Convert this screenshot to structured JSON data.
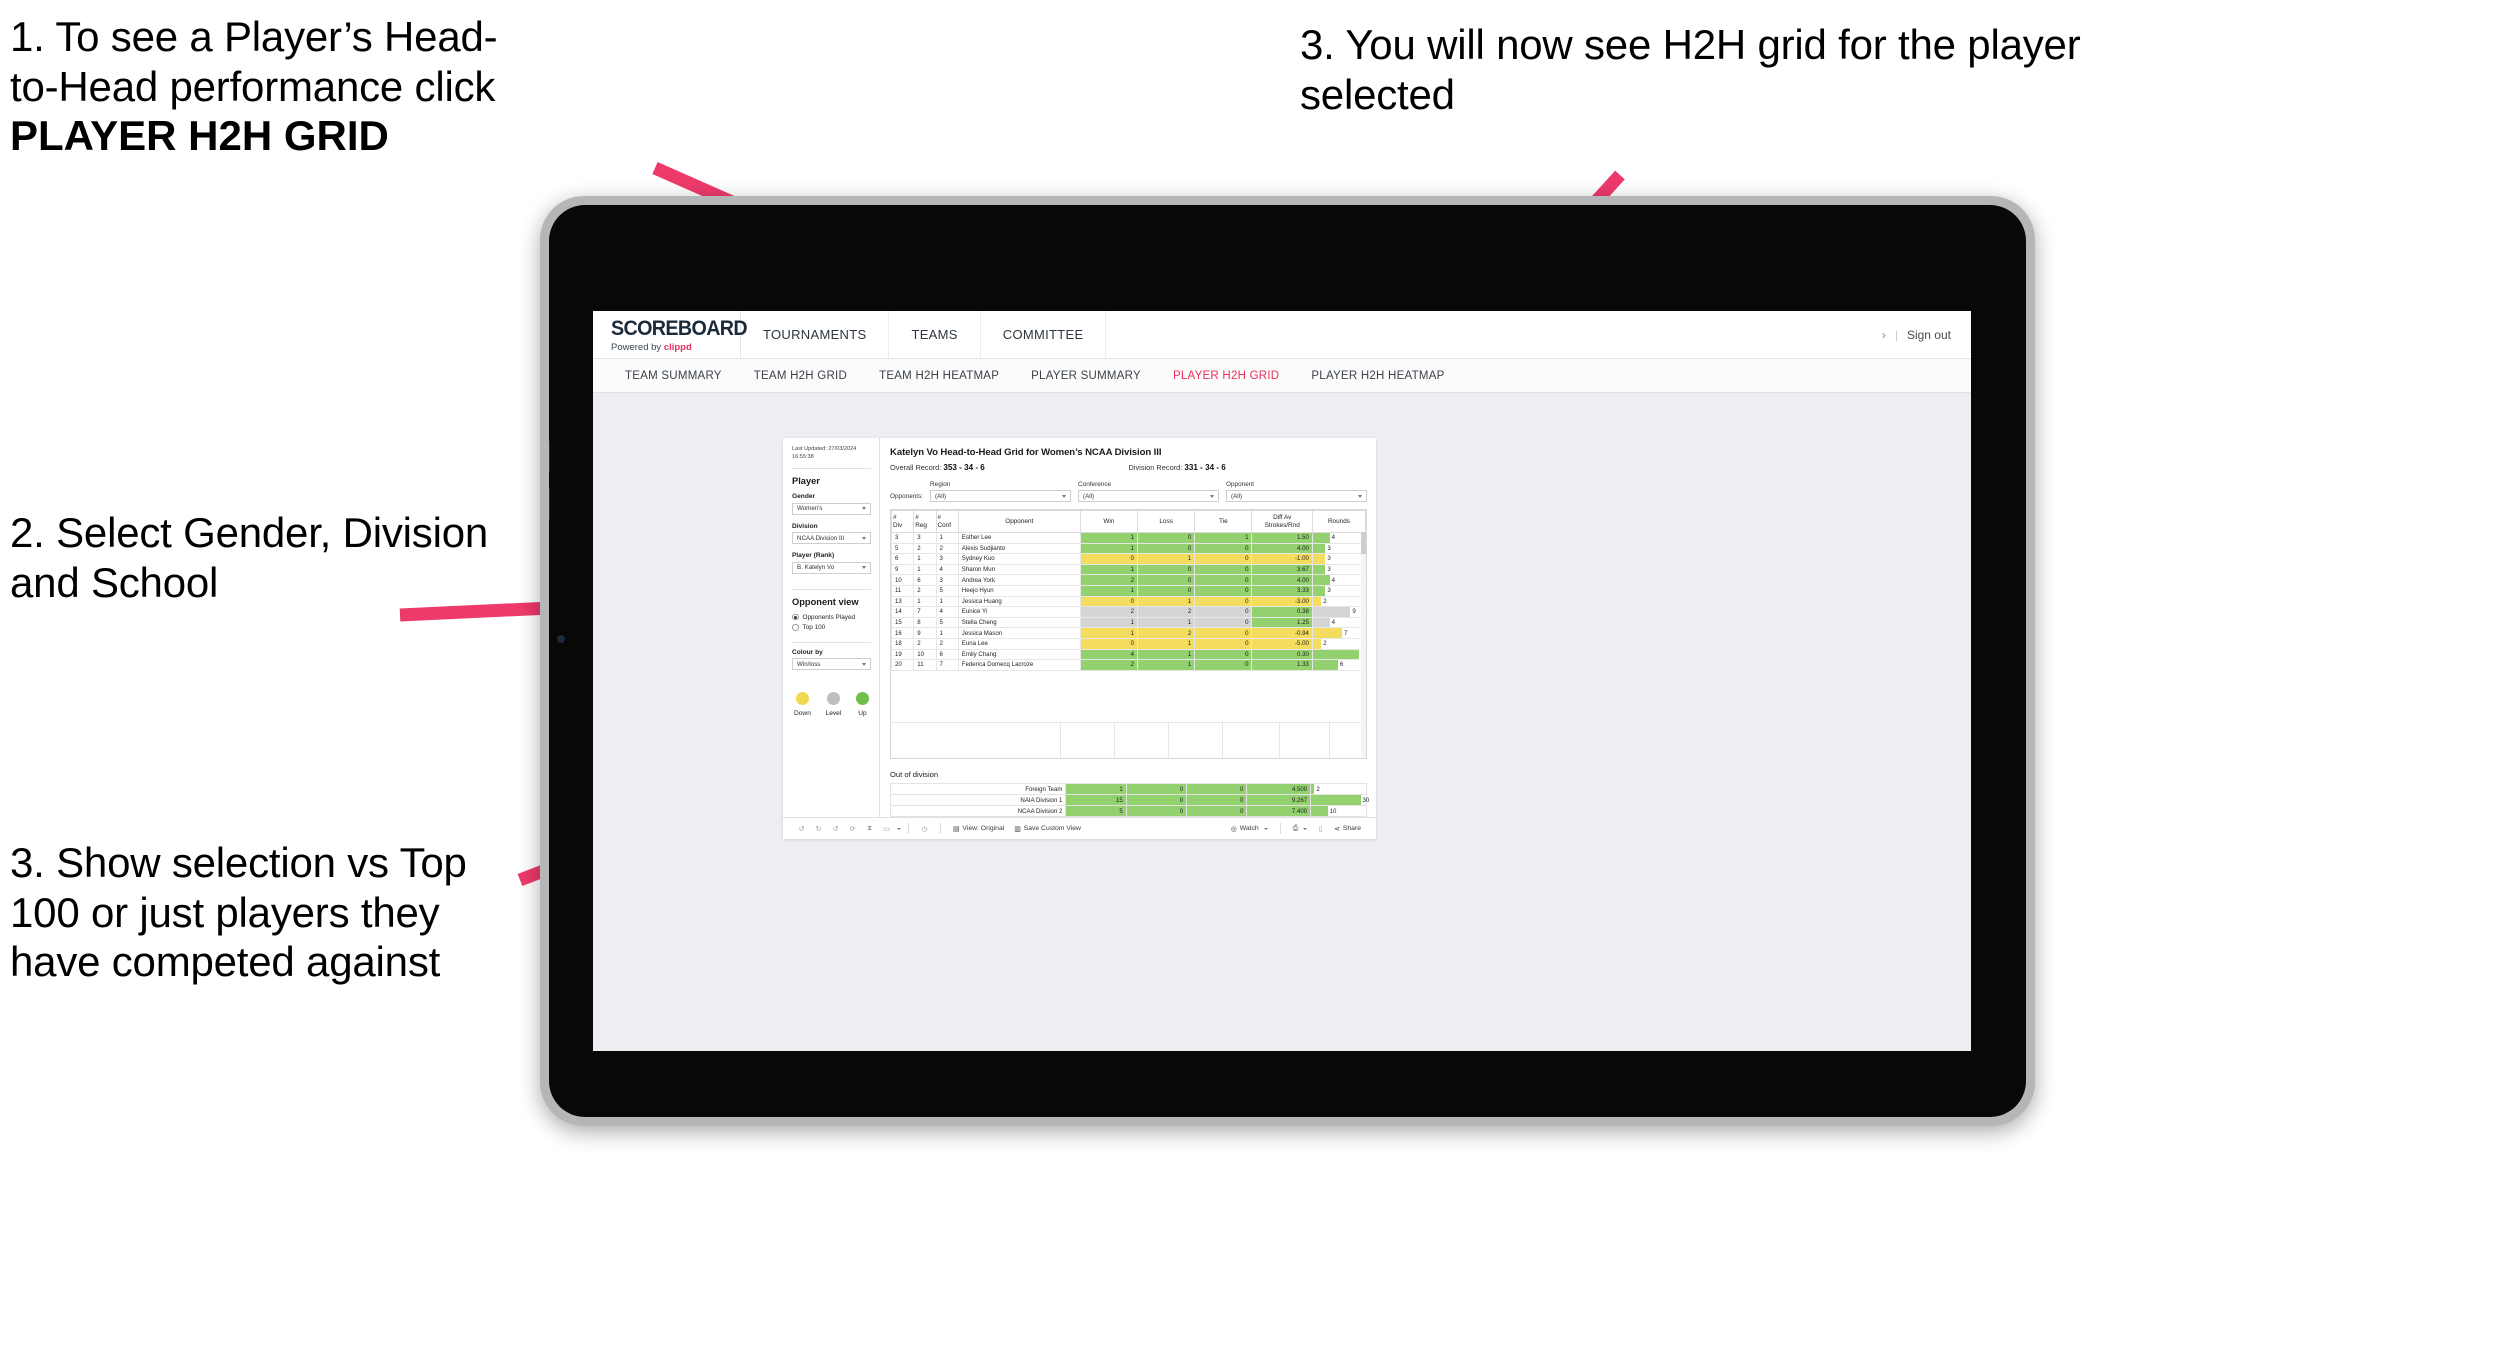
{
  "annotations": {
    "a1_line1": "1. To see a Player’s Head-",
    "a1_line2": "to-Head performance click",
    "a1_bold": "PLAYER H2H GRID",
    "a2": "2. Select Gender, Division and School",
    "a3": "3. Show selection vs Top 100 or just players they have competed against",
    "a4": "3. You will now see H2H grid for the player selected",
    "arrow_color": "#ee3a6b"
  },
  "app": {
    "brand": {
      "logo": "SCOREBOARD",
      "powered_prefix": "Powered by ",
      "powered_brand": "clippd"
    },
    "topnav": [
      "TOURNAMENTS",
      "TEAMS",
      "COMMITTEE"
    ],
    "account": {
      "chevron": "›",
      "divider": "|",
      "sign_out": "Sign out"
    },
    "subnav": [
      {
        "label": "TEAM SUMMARY",
        "active": false
      },
      {
        "label": "TEAM H2H GRID",
        "active": false
      },
      {
        "label": "TEAM H2H HEATMAP",
        "active": false
      },
      {
        "label": "PLAYER SUMMARY",
        "active": false
      },
      {
        "label": "PLAYER H2H GRID",
        "active": true
      },
      {
        "label": "PLAYER H2H HEATMAP",
        "active": false
      }
    ],
    "accent": "#e8305c"
  },
  "pane": {
    "updated_label": "Last Updated: 27/03/2024",
    "updated_time": "16:55:38",
    "player_heading": "Player",
    "filters": [
      {
        "label": "Gender",
        "value": "Women's"
      },
      {
        "label": "Division",
        "value": "NCAA Division III"
      },
      {
        "label": "Player (Rank)",
        "value": "B. Katelyn Vo"
      }
    ],
    "opponent_view_heading": "Opponent view",
    "opponent_view_options": [
      {
        "label": "Opponents Played",
        "selected": true
      },
      {
        "label": "Top 100",
        "selected": false
      }
    ],
    "colour_by_label": "Colour by",
    "colour_by_value": "Win/loss",
    "legend": [
      {
        "label": "Down",
        "color": "#f2d84f"
      },
      {
        "label": "Level",
        "color": "#bfbfbf"
      },
      {
        "label": "Up",
        "color": "#6fbf4a"
      }
    ]
  },
  "viz": {
    "title": "Katelyn Vo Head-to-Head Grid for Women’s NCAA Division III",
    "overall_record_label": "Overall Record:",
    "overall_record_value": "353 - 34 - 6",
    "division_record_label": "Division Record:",
    "division_record_value": "331 - 34 - 6",
    "opponents_label": "Opponents:",
    "opponent_filters": [
      {
        "label": "Region",
        "value": "(All)"
      },
      {
        "label": "Conference",
        "value": "(All)"
      },
      {
        "label": "Opponent",
        "value": "(All)"
      }
    ],
    "out_of_division_title": "Out of division"
  },
  "chart_data": {
    "type": "table",
    "title": "Katelyn Vo Head-to-Head Grid for Women’s NCAA Division III",
    "columns": [
      "# Div",
      "# Reg",
      "# Conf",
      "Opponent",
      "Win",
      "Loss",
      "Tie",
      "Diff Av Strokes/Rnd",
      "Rounds"
    ],
    "column_headers_two_line": {
      "div": [
        "#",
        "Div"
      ],
      "reg": [
        "#",
        "Reg"
      ],
      "conf": [
        "#",
        "Conf"
      ],
      "opponent": [
        "Opponent"
      ],
      "win": [
        "Win"
      ],
      "loss": [
        "Loss"
      ],
      "tie": [
        "Tie"
      ],
      "diff": [
        "Diff Av",
        "Strokes/Rnd"
      ],
      "rounds": [
        "Rounds"
      ]
    },
    "colour_by": "Win/loss",
    "colour_map": {
      "up": "#93d06e",
      "down": "#f3dc5e",
      "level": "#d4d4d4"
    },
    "rounds_max": 11,
    "rows": [
      {
        "div": "3",
        "reg": "3",
        "conf": "1",
        "opponent": "Esther Lee",
        "win": "1",
        "loss": "0",
        "tie": "1",
        "diff": "1.50",
        "rounds": 4,
        "state": "up"
      },
      {
        "div": "5",
        "reg": "2",
        "conf": "2",
        "opponent": "Alexis Sudjianto",
        "win": "1",
        "loss": "0",
        "tie": "0",
        "diff": "4.00",
        "rounds": 3,
        "state": "up"
      },
      {
        "div": "6",
        "reg": "1",
        "conf": "3",
        "opponent": "Sydney Kuo",
        "win": "0",
        "loss": "1",
        "tie": "0",
        "diff": "-1.00",
        "rounds": 3,
        "state": "down"
      },
      {
        "div": "9",
        "reg": "1",
        "conf": "4",
        "opponent": "Sharon Mun",
        "win": "1",
        "loss": "0",
        "tie": "0",
        "diff": "3.67",
        "rounds": 3,
        "state": "up"
      },
      {
        "div": "10",
        "reg": "6",
        "conf": "3",
        "opponent": "Andrea York",
        "win": "2",
        "loss": "0",
        "tie": "0",
        "diff": "4.00",
        "rounds": 4,
        "state": "up"
      },
      {
        "div": "11",
        "reg": "2",
        "conf": "5",
        "opponent": "Heejo Hyun",
        "win": "1",
        "loss": "0",
        "tie": "0",
        "diff": "3.33",
        "rounds": 3,
        "state": "up"
      },
      {
        "div": "13",
        "reg": "1",
        "conf": "1",
        "opponent": "Jessica Huang",
        "win": "0",
        "loss": "1",
        "tie": "0",
        "diff": "-3.00",
        "rounds": 2,
        "state": "down"
      },
      {
        "div": "14",
        "reg": "7",
        "conf": "4",
        "opponent": "Eunice Yi",
        "win": "2",
        "loss": "2",
        "tie": "0",
        "diff": "0.38",
        "rounds": 9,
        "state": "level",
        "diff_state": "up"
      },
      {
        "div": "15",
        "reg": "8",
        "conf": "5",
        "opponent": "Stella Cheng",
        "win": "1",
        "loss": "1",
        "tie": "0",
        "diff": "1.25",
        "rounds": 4,
        "state": "level",
        "diff_state": "up"
      },
      {
        "div": "16",
        "reg": "9",
        "conf": "1",
        "opponent": "Jessica Mason",
        "win": "1",
        "loss": "2",
        "tie": "0",
        "diff": "-0.94",
        "rounds": 7,
        "state": "down"
      },
      {
        "div": "18",
        "reg": "2",
        "conf": "2",
        "opponent": "Euna Lee",
        "win": "0",
        "loss": "1",
        "tie": "0",
        "diff": "-5.00",
        "rounds": 2,
        "state": "down"
      },
      {
        "div": "19",
        "reg": "10",
        "conf": "6",
        "opponent": "Emily Chang",
        "win": "4",
        "loss": "1",
        "tie": "0",
        "diff": "0.30",
        "rounds": 11,
        "state": "up"
      },
      {
        "div": "20",
        "reg": "11",
        "conf": "7",
        "opponent": "Federica Domecq Lacroze",
        "win": "2",
        "loss": "1",
        "tie": "0",
        "diff": "1.33",
        "rounds": 6,
        "state": "up"
      }
    ],
    "out_of_division": {
      "rounds_max": 30,
      "rows": [
        {
          "name": "Foreign Team",
          "win": "1",
          "loss": "0",
          "tie": "0",
          "diff": "4.500",
          "rounds": 2,
          "state": "up"
        },
        {
          "name": "NAIA Division 1",
          "win": "15",
          "loss": "0",
          "tie": "0",
          "diff": "9.267",
          "rounds": 30,
          "state": "up"
        },
        {
          "name": "NCAA Division 2",
          "win": "5",
          "loss": "0",
          "tie": "0",
          "diff": "7.400",
          "rounds": 10,
          "state": "up"
        }
      ]
    }
  },
  "toolbar": {
    "icons": [
      "undo-icon",
      "redo-icon",
      "revert-icon",
      "refresh-icon",
      "pause-icon",
      "rectangle-select-icon"
    ],
    "view_label": "View: Original",
    "save_custom_view_label": "Save Custom View",
    "watch_label": "Watch",
    "share_label": "Share"
  }
}
